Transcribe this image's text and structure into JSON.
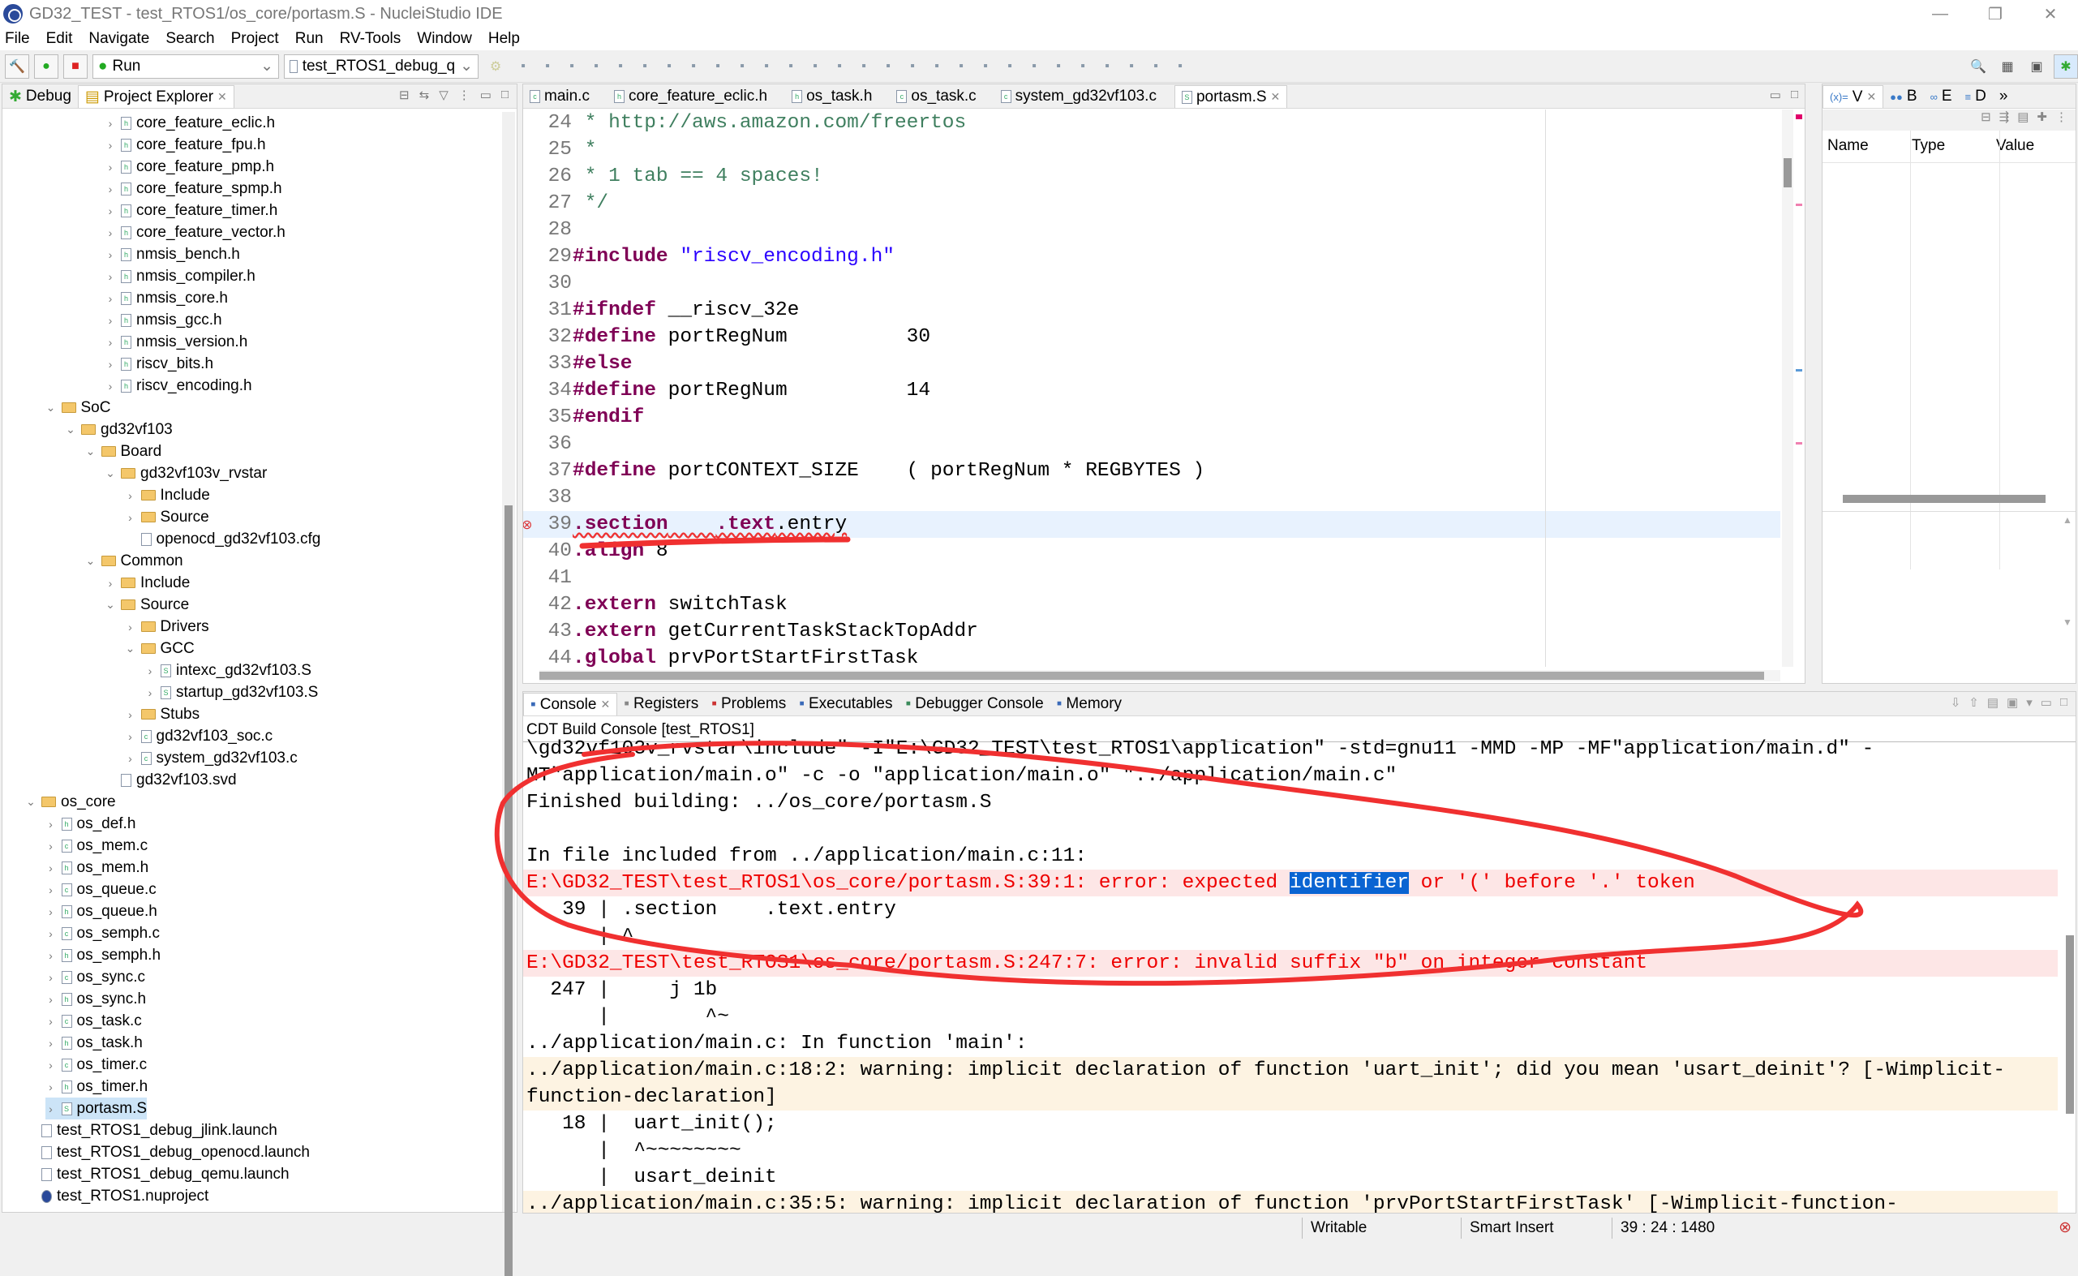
{
  "window": {
    "title": "GD32_TEST - test_RTOS1/os_core/portasm.S - NucleiStudio IDE",
    "min": "—",
    "max": "❐",
    "close": "✕"
  },
  "menu": [
    "File",
    "Edit",
    "Navigate",
    "Search",
    "Project",
    "Run",
    "RV-Tools",
    "Window",
    "Help"
  ],
  "toolbar": {
    "mode": "Run",
    "launch_config": "test_RTOS1_debug_q"
  },
  "left_panel": {
    "tabs": [
      {
        "label": "Debug",
        "active": false
      },
      {
        "label": "Project Explorer",
        "active": true
      }
    ],
    "tree": [
      {
        "level": 4,
        "chev": "›",
        "type": "h",
        "label": "core_feature_eclic.h"
      },
      {
        "level": 4,
        "chev": "›",
        "type": "h",
        "label": "core_feature_fpu.h"
      },
      {
        "level": 4,
        "chev": "›",
        "type": "h",
        "label": "core_feature_pmp.h"
      },
      {
        "level": 4,
        "chev": "›",
        "type": "h",
        "label": "core_feature_spmp.h"
      },
      {
        "level": 4,
        "chev": "›",
        "type": "h",
        "label": "core_feature_timer.h"
      },
      {
        "level": 4,
        "chev": "›",
        "type": "h",
        "label": "core_feature_vector.h"
      },
      {
        "level": 4,
        "chev": "›",
        "type": "h",
        "label": "nmsis_bench.h"
      },
      {
        "level": 4,
        "chev": "›",
        "type": "h",
        "label": "nmsis_compiler.h"
      },
      {
        "level": 4,
        "chev": "›",
        "type": "h",
        "label": "nmsis_core.h"
      },
      {
        "level": 4,
        "chev": "›",
        "type": "h",
        "label": "nmsis_gcc.h"
      },
      {
        "level": 4,
        "chev": "›",
        "type": "h",
        "label": "nmsis_version.h"
      },
      {
        "level": 4,
        "chev": "›",
        "type": "h",
        "label": "riscv_bits.h"
      },
      {
        "level": 4,
        "chev": "›",
        "type": "h",
        "label": "riscv_encoding.h"
      },
      {
        "level": 1,
        "chev": "⌄",
        "type": "folder",
        "label": "SoC"
      },
      {
        "level": 2,
        "chev": "⌄",
        "type": "folder",
        "label": "gd32vf103"
      },
      {
        "level": 3,
        "chev": "⌄",
        "type": "folder",
        "label": "Board"
      },
      {
        "level": 4,
        "chev": "⌄",
        "type": "folder",
        "label": "gd32vf103v_rvstar"
      },
      {
        "level": 5,
        "chev": "›",
        "type": "folder",
        "label": "Include"
      },
      {
        "level": 5,
        "chev": "›",
        "type": "folder",
        "label": "Source"
      },
      {
        "level": 5,
        "chev": "",
        "type": "file",
        "label": "openocd_gd32vf103.cfg"
      },
      {
        "level": 3,
        "chev": "⌄",
        "type": "folder",
        "label": "Common"
      },
      {
        "level": 4,
        "chev": "›",
        "type": "folder",
        "label": "Include"
      },
      {
        "level": 4,
        "chev": "⌄",
        "type": "folder",
        "label": "Source"
      },
      {
        "level": 5,
        "chev": "›",
        "type": "folder",
        "label": "Drivers"
      },
      {
        "level": 5,
        "chev": "⌄",
        "type": "folder",
        "label": "GCC"
      },
      {
        "level": 6,
        "chev": "›",
        "type": "S",
        "label": "intexc_gd32vf103.S"
      },
      {
        "level": 6,
        "chev": "›",
        "type": "S",
        "label": "startup_gd32vf103.S"
      },
      {
        "level": 5,
        "chev": "›",
        "type": "folder",
        "label": "Stubs"
      },
      {
        "level": 5,
        "chev": "›",
        "type": "c",
        "label": "gd32vf103_soc.c"
      },
      {
        "level": 5,
        "chev": "›",
        "type": "c",
        "label": "system_gd32vf103.c"
      },
      {
        "level": 4,
        "chev": "",
        "type": "file",
        "label": "gd32vf103.svd"
      },
      {
        "level": 0,
        "chev": "⌄",
        "type": "folder",
        "label": "os_core"
      },
      {
        "level": 1,
        "chev": "›",
        "type": "h",
        "label": "os_def.h"
      },
      {
        "level": 1,
        "chev": "›",
        "type": "c",
        "label": "os_mem.c"
      },
      {
        "level": 1,
        "chev": "›",
        "type": "h",
        "label": "os_mem.h"
      },
      {
        "level": 1,
        "chev": "›",
        "type": "c",
        "label": "os_queue.c"
      },
      {
        "level": 1,
        "chev": "›",
        "type": "h",
        "label": "os_queue.h"
      },
      {
        "level": 1,
        "chev": "›",
        "type": "c",
        "label": "os_semph.c"
      },
      {
        "level": 1,
        "chev": "›",
        "type": "h",
        "label": "os_semph.h"
      },
      {
        "level": 1,
        "chev": "›",
        "type": "c",
        "label": "os_sync.c"
      },
      {
        "level": 1,
        "chev": "›",
        "type": "h",
        "label": "os_sync.h"
      },
      {
        "level": 1,
        "chev": "›",
        "type": "c",
        "label": "os_task.c"
      },
      {
        "level": 1,
        "chev": "›",
        "type": "h",
        "label": "os_task.h"
      },
      {
        "level": 1,
        "chev": "›",
        "type": "c",
        "label": "os_timer.c"
      },
      {
        "level": 1,
        "chev": "›",
        "type": "h",
        "label": "os_timer.h"
      },
      {
        "level": 1,
        "chev": "›",
        "type": "S",
        "label": "portasm.S",
        "selected": true
      },
      {
        "level": 0,
        "chev": "",
        "type": "file",
        "label": "test_RTOS1_debug_jlink.launch"
      },
      {
        "level": 0,
        "chev": "",
        "type": "file",
        "label": "test_RTOS1_debug_openocd.launch"
      },
      {
        "level": 0,
        "chev": "",
        "type": "file",
        "label": "test_RTOS1_debug_qemu.launch"
      },
      {
        "level": 0,
        "chev": "",
        "type": "project",
        "label": "test_RTOS1.nuproject"
      }
    ]
  },
  "editor": {
    "tabs": [
      {
        "label": "main.c",
        "type": "c"
      },
      {
        "label": "core_feature_eclic.h",
        "type": "h"
      },
      {
        "label": "os_task.h",
        "type": "h"
      },
      {
        "label": "os_task.c",
        "type": "c"
      },
      {
        "label": "system_gd32vf103.c",
        "type": "c"
      },
      {
        "label": "portasm.S",
        "type": "S",
        "active": true
      }
    ],
    "error_line": "39",
    "lines": [
      {
        "n": "24",
        "s": [
          {
            "c": "cm",
            "t": " * http://aws.amazon.com/freertos"
          }
        ]
      },
      {
        "n": "25",
        "s": [
          {
            "c": "cm",
            "t": " *"
          }
        ]
      },
      {
        "n": "26",
        "s": [
          {
            "c": "cm",
            "t": " * 1 tab == 4 spaces!"
          }
        ]
      },
      {
        "n": "27",
        "s": [
          {
            "c": "cm",
            "t": " */"
          }
        ]
      },
      {
        "n": "28",
        "s": []
      },
      {
        "n": "29",
        "s": [
          {
            "c": "kw",
            "t": "#include"
          },
          {
            "c": "",
            "t": " "
          },
          {
            "c": "str",
            "t": "\"riscv_encoding.h\""
          }
        ]
      },
      {
        "n": "30",
        "s": []
      },
      {
        "n": "31",
        "s": [
          {
            "c": "kw",
            "t": "#ifndef"
          },
          {
            "c": "",
            "t": " __riscv_32e"
          }
        ]
      },
      {
        "n": "32",
        "s": [
          {
            "c": "kw",
            "t": "#define"
          },
          {
            "c": "",
            "t": " portRegNum          30"
          }
        ]
      },
      {
        "n": "33",
        "s": [
          {
            "c": "kw",
            "t": "#else"
          }
        ]
      },
      {
        "n": "34",
        "s": [
          {
            "c": "kw",
            "t": "#define"
          },
          {
            "c": "",
            "t": " portRegNum          14"
          }
        ]
      },
      {
        "n": "35",
        "s": [
          {
            "c": "kw",
            "t": "#endif"
          }
        ]
      },
      {
        "n": "36",
        "s": []
      },
      {
        "n": "37",
        "s": [
          {
            "c": "kw",
            "t": "#define"
          },
          {
            "c": "",
            "t": " portCONTEXT_SIZE    ( portRegNum * REGBYTES )"
          }
        ]
      },
      {
        "n": "38",
        "s": []
      },
      {
        "n": "39",
        "s": [
          {
            "c": "kw",
            "t": ".section"
          },
          {
            "c": "",
            "t": "    "
          },
          {
            "c": "kw",
            "t": ".text"
          },
          {
            "c": "",
            "t": ".entry"
          }
        ],
        "current": true
      },
      {
        "n": "40",
        "s": [
          {
            "c": "kw",
            "t": ".align"
          },
          {
            "c": "",
            "t": " 8"
          }
        ]
      },
      {
        "n": "41",
        "s": []
      },
      {
        "n": "42",
        "s": [
          {
            "c": "kw",
            "t": ".extern"
          },
          {
            "c": "",
            "t": " switchTask"
          }
        ]
      },
      {
        "n": "43",
        "s": [
          {
            "c": "kw",
            "t": ".extern"
          },
          {
            "c": "",
            "t": " getCurrentTaskStackTopAddr"
          }
        ]
      },
      {
        "n": "44",
        "s": [
          {
            "c": "kw",
            "t": ".global"
          },
          {
            "c": "",
            "t": " prvPortStartFirstTask"
          }
        ]
      }
    ]
  },
  "right_panel": {
    "tabs": [
      "V",
      "B",
      "E",
      "D"
    ],
    "columns": [
      "Name",
      "Type",
      "Value"
    ]
  },
  "console": {
    "tabs": [
      "Console",
      "Registers",
      "Problems",
      "Executables",
      "Debugger Console",
      "Memory"
    ],
    "title": "CDT Build Console [test_RTOS1]",
    "lines": [
      {
        "k": "",
        "s": [
          "\\gd32vf103v_rvstar\\include\" -I\"E:\\GD32_TEST\\test_RTOS1\\application\" -std=gnu11 -MMD -MP -MF\"application/main.d\" -"
        ]
      },
      {
        "k": "",
        "s": [
          "MT\"application/main.o\" -c -o \"application/main.o\" \"../application/main.c\""
        ]
      },
      {
        "k": "",
        "s": [
          "Finished building: ../os_core/portasm.S"
        ]
      },
      {
        "k": "",
        "s": [
          ""
        ]
      },
      {
        "k": "",
        "s": [
          "In file included from ../application/main.c:11:"
        ]
      },
      {
        "k": "err",
        "s": [
          "E:\\GD32_TEST\\test_RTOS1\\os_core/portasm.S:39:1: error: expected ",
          "identifier",
          " or '(' before '.' token"
        ]
      },
      {
        "k": "",
        "s": [
          "   39 | .section    .text.entry"
        ]
      },
      {
        "k": "",
        "s": [
          "      | ^"
        ]
      },
      {
        "k": "err",
        "s": [
          "E:\\GD32_TEST\\test_RTOS1\\os_core/portasm.S:247:7: error: invalid suffix \"b\" on integer constant"
        ]
      },
      {
        "k": "",
        "s": [
          "  247 |     j 1b"
        ]
      },
      {
        "k": "",
        "s": [
          "      |        ^~"
        ]
      },
      {
        "k": "",
        "s": [
          "../application/main.c: In function 'main':"
        ]
      },
      {
        "k": "warn",
        "s": [
          "../application/main.c:18:2: warning: implicit declaration of function 'uart_init'; did you mean 'usart_deinit'? [-Wimplicit-"
        ]
      },
      {
        "k": "warn",
        "s": [
          "function-declaration]"
        ]
      },
      {
        "k": "",
        "s": [
          "   18 |  uart_init();"
        ]
      },
      {
        "k": "",
        "s": [
          "      |  ^~~~~~~~~"
        ]
      },
      {
        "k": "",
        "s": [
          "      |  usart_deinit"
        ]
      },
      {
        "k": "warn",
        "s": [
          "../application/main.c:35:5: warning: implicit declaration of function 'prvPortStartFirstTask' [-Wimplicit-function-"
        ]
      }
    ]
  },
  "status": {
    "writable": "Writable",
    "insert_mode": "Smart Insert",
    "position": "39 : 24 : 1480"
  },
  "colors": {
    "annotation": "#f03030",
    "keyword": "#7f0055",
    "comment": "#3f7f5f",
    "string": "#2a00ff",
    "error_bg": "#fde6e6",
    "warning_bg": "#fdf3e2",
    "selection": "#0a64d2"
  }
}
